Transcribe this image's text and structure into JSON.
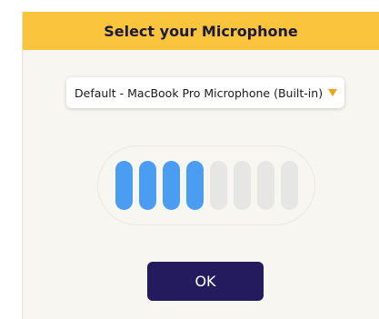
{
  "dialog": {
    "title": "Select your Microphone"
  },
  "microphone_select": {
    "selected": "Default - MacBook Pro Microphone (Built-in)",
    "arrow_icon": "triangle-down-icon",
    "arrow_color": "#f2a31b"
  },
  "level_meter": {
    "total_bars": 8,
    "active_bars": 4,
    "level": 0.5,
    "active_color": "#4a9df0",
    "inactive_color": "#e6e6e4"
  },
  "ok_button": {
    "label": "OK"
  },
  "colors": {
    "header": "#fbc43d",
    "button": "#241b5e",
    "background": "#f7f6f1"
  }
}
